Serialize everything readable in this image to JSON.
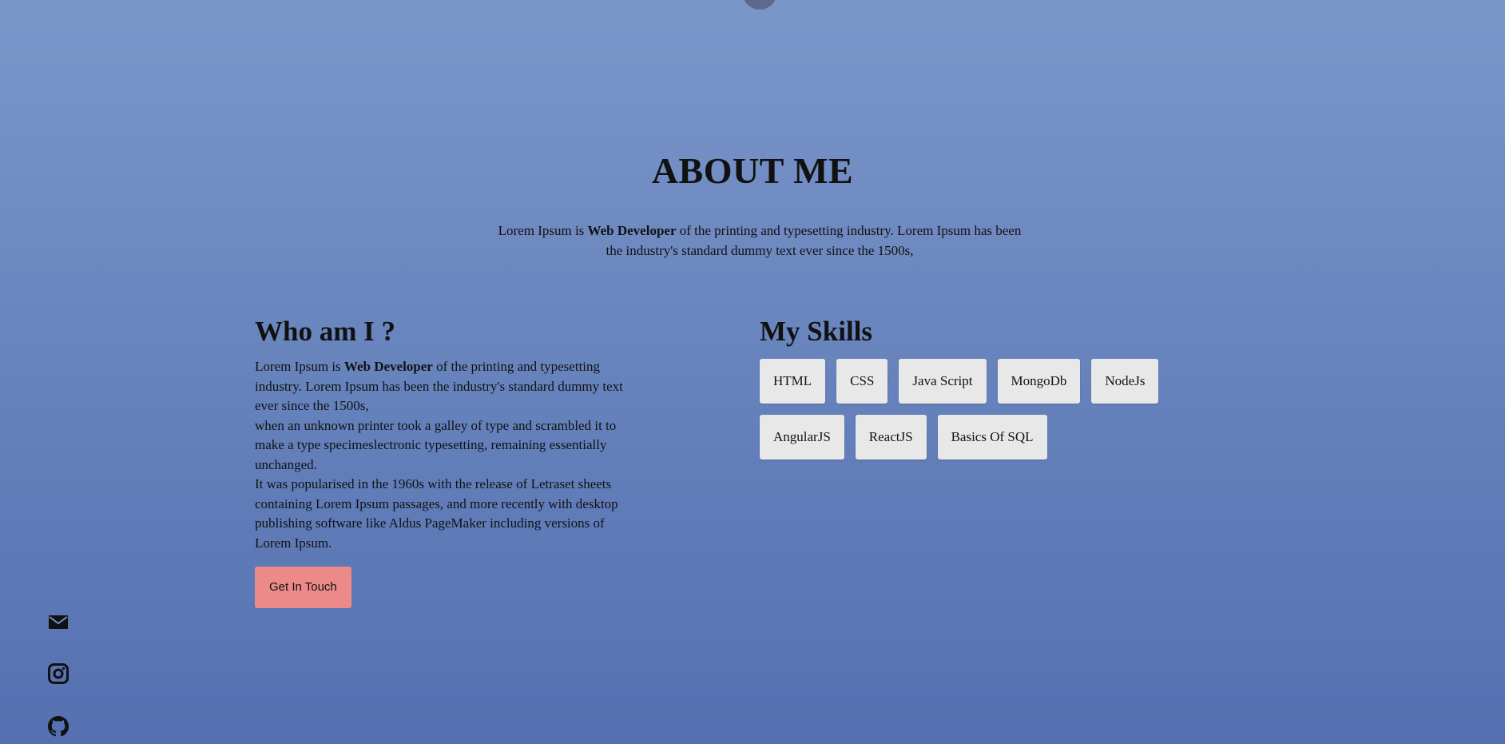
{
  "about": {
    "title": "ABOUT ME",
    "intro": {
      "before": "Lorem Ipsum is ",
      "bold": "Web Developer",
      "after": " of the printing and typesetting industry. Lorem Ipsum has been the industry's standard dummy text ever since the 1500s,"
    }
  },
  "who": {
    "heading": "Who am I ?",
    "p1": {
      "before": "Lorem Ipsum is ",
      "bold": "Web Developer",
      "after": " of the printing and typesetting industry. Lorem Ipsum has been the industry's standard dummy text ever since the 1500s,"
    },
    "p2": "when an unknown printer took a galley of type and scrambled it to make a type specimeslectronic typesetting, remaining essentially unchanged.",
    "p3": "It was popularised in the 1960s with the release of Letraset sheets containing Lorem Ipsum passages, and more recently with desktop publishing software like Aldus PageMaker including versions of Lorem Ipsum.",
    "cta_label": "Get In Touch"
  },
  "skills": {
    "heading": "My Skills",
    "items": [
      "HTML",
      "CSS",
      "Java Script",
      "MongoDb",
      "NodeJs",
      "AngularJS",
      "ReactJS",
      "Basics Of SQL"
    ]
  },
  "social": {
    "icons": [
      "mail-icon",
      "instagram-icon",
      "github-icon"
    ]
  },
  "colors": {
    "background_top": "#7b96c9",
    "background_bottom": "#5470b0",
    "cta_background": "#ec8989",
    "skill_background": "#e8e8e8"
  }
}
